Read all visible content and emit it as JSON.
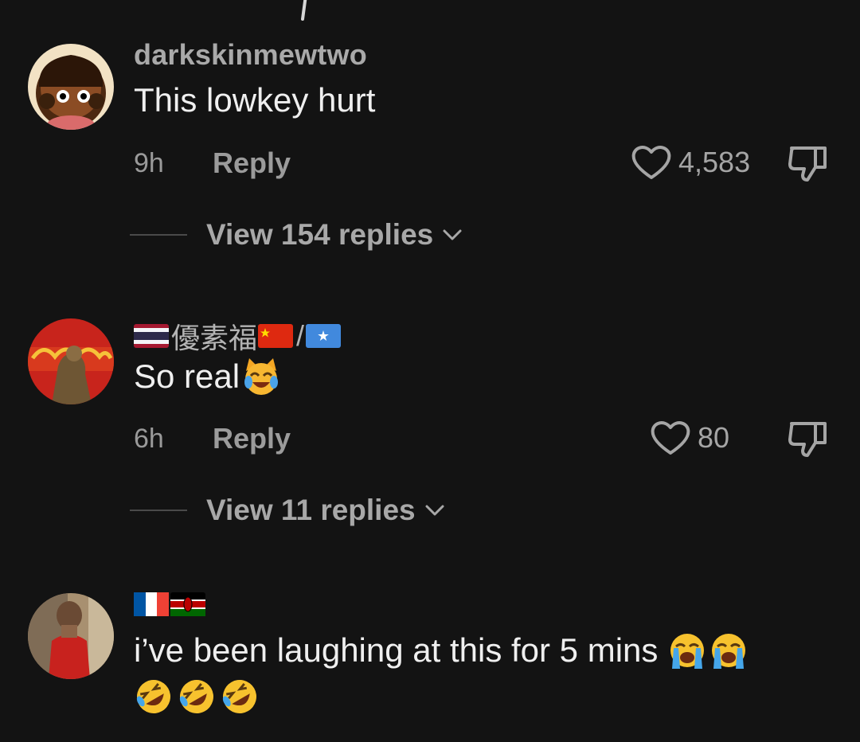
{
  "comments": [
    {
      "username": "darkskinmewtwo",
      "text": "This lowkey hurt",
      "time": "9h",
      "reply_label": "Reply",
      "likes": "4,583",
      "view_replies": "View 154 replies",
      "avatar_icon": "cartoon-character-avatar"
    },
    {
      "username_parts": [
        "🇹🇭",
        "優素福",
        "🇨🇳",
        "/",
        "🇸🇴"
      ],
      "name_text": "優素福",
      "slash": "/",
      "text": "So real",
      "text_emoji": "cat-tears-of-joy-emoji",
      "time": "6h",
      "reply_label": "Reply",
      "likes": "80",
      "view_replies": "View 11 replies",
      "avatar_icon": "red-banner-statue-avatar"
    },
    {
      "username_parts": [
        "🇫🇷",
        "🇰🇪"
      ],
      "text": "i’ve been laughing at this for 5 mins",
      "text_emoji": [
        "loudly-crying-emoji",
        "loudly-crying-emoji"
      ],
      "second_line_emoji": [
        "rolling-laughing-emoji",
        "rolling-laughing-emoji",
        "rolling-laughing-emoji"
      ],
      "avatar_icon": "person-photo-avatar"
    }
  ],
  "colors": {
    "background": "#131313",
    "text": "#efefef",
    "secondary_text": "#9b9b9b"
  }
}
